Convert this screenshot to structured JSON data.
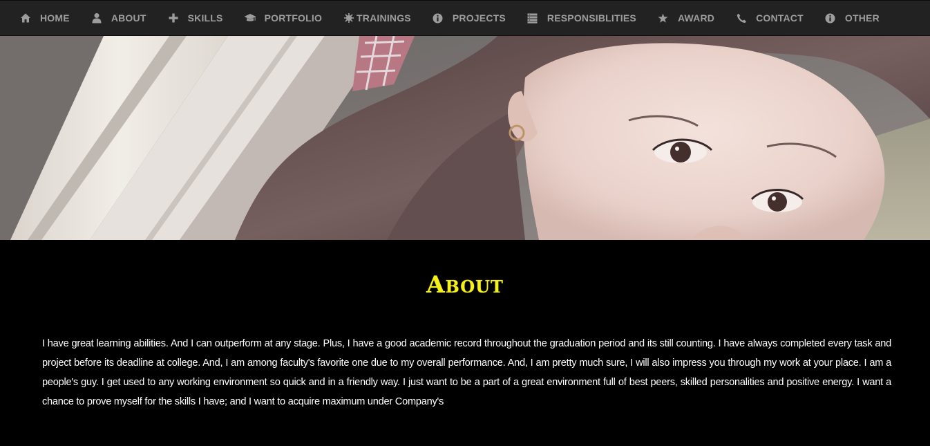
{
  "nav": {
    "items": [
      {
        "label": "HOME",
        "icon": "home-icon"
      },
      {
        "label": "ABOUT",
        "icon": "user-icon"
      },
      {
        "label": "SKILLS",
        "icon": "plus-icon"
      },
      {
        "label": "PORTFOLIO",
        "icon": "graduation-cap-icon"
      },
      {
        "label": "TRAININGS",
        "icon": "asterisk-icon"
      },
      {
        "label": "PROJECTS",
        "icon": "info-icon"
      },
      {
        "label": "RESPONSIBLITIES",
        "icon": "list-icon"
      },
      {
        "label": "AWARD",
        "icon": "star-icon"
      },
      {
        "label": "CONTACT",
        "icon": "phone-icon"
      },
      {
        "label": "OTHER",
        "icon": "info-icon"
      }
    ]
  },
  "about": {
    "title": "About",
    "text": "I have great learning abilities. And I can outperform at any stage. Plus, I have a good academic record throughout the graduation period and its still counting. I have always completed every task and project before its deadline at college. And, I am among faculty's favorite one due to my overall performance. And, I am pretty much sure, I will also impress you through my work at your place. I am a people's guy. I get used to any working environment so quick and in a friendly way. I just want to be a part of a great environment full of best peers, skilled personalities and positive energy. I want a chance to prove myself for the skills I have; and I want to acquire maximum under Company's"
  },
  "colors": {
    "navbar_bg": "#222222",
    "nav_text": "#9d9d9d",
    "title": "#f5f01a",
    "body_text": "#ffffff",
    "content_bg": "#000000"
  }
}
